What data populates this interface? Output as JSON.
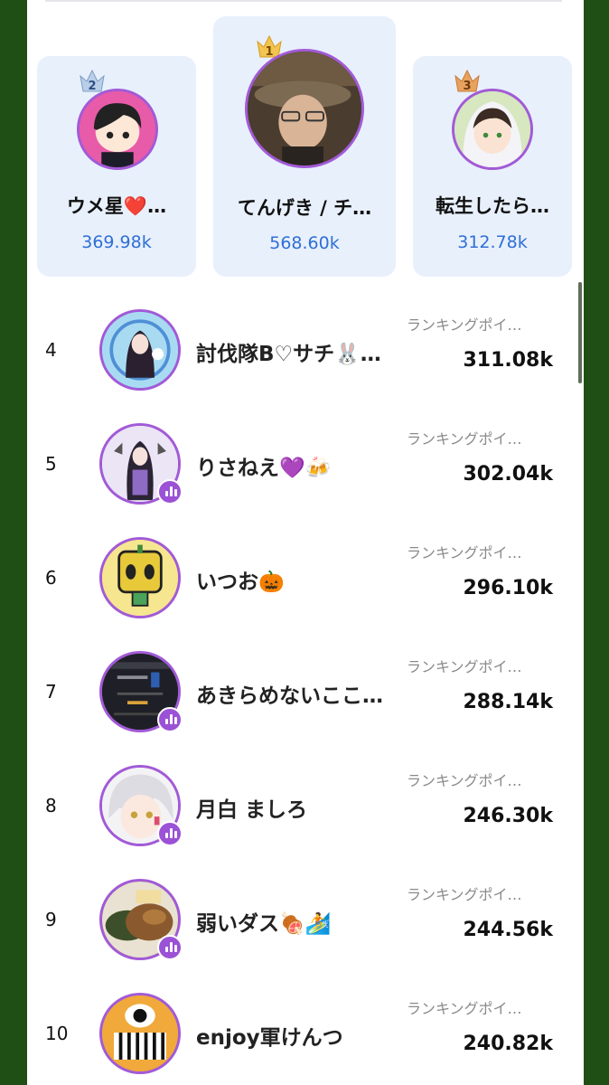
{
  "podium": [
    {
      "rank": "1",
      "name": "てんげき / チ…",
      "points": "568.60k"
    },
    {
      "rank": "2",
      "name": "ウメ星❤️…",
      "points": "369.98k"
    },
    {
      "rank": "3",
      "name": "転生したら…",
      "points": "312.78k"
    }
  ],
  "list": [
    {
      "rank": "4",
      "name": "討伐隊B♡サチ🐰…",
      "label": "ランキングポイ…",
      "points": "311.08k"
    },
    {
      "rank": "5",
      "name": "りさねえ💜🍻",
      "label": "ランキングポイ…",
      "points": "302.04k"
    },
    {
      "rank": "6",
      "name": "いつお🎃",
      "label": "ランキングポイ…",
      "points": "296.10k"
    },
    {
      "rank": "7",
      "name": "あきらめないここ…",
      "label": "ランキングポイ…",
      "points": "288.14k"
    },
    {
      "rank": "8",
      "name": "月白 ましろ",
      "label": "ランキングポイ…",
      "points": "246.30k"
    },
    {
      "rank": "9",
      "name": "弱いダス🍖🏄",
      "label": "ランキングポイ…",
      "points": "244.56k"
    },
    {
      "rank": "10",
      "name": "enjoy軍けんつ",
      "label": "ランキングポイ…",
      "points": "240.82k"
    }
  ],
  "colors": {
    "crown_gold": "#f3c44f",
    "crown_silver": "#b9cfe8",
    "crown_bronze": "#e9a15e",
    "accent_purple": "#a25ad7",
    "points_blue": "#2f6fd6"
  }
}
